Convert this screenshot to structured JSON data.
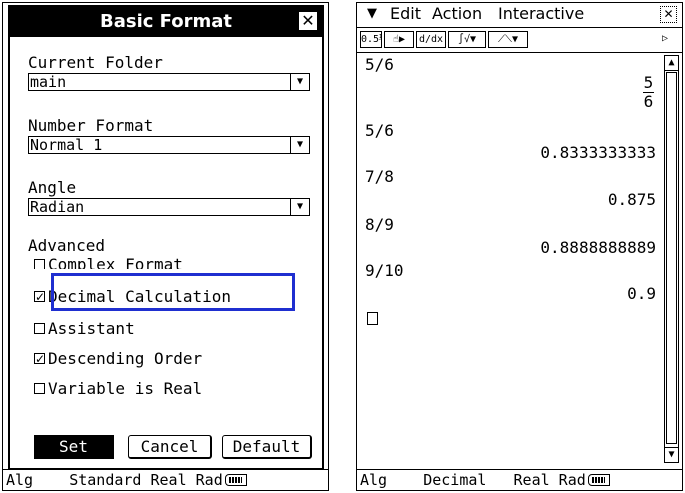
{
  "dialog": {
    "title": "Basic Format",
    "close_icon": "close-icon",
    "current_folder": {
      "label": "Current Folder",
      "value": "main"
    },
    "number_format": {
      "label": "Number Format",
      "value": "Normal 1"
    },
    "angle": {
      "label": "Angle",
      "value": "Radian"
    },
    "advanced": {
      "label": "Advanced",
      "options": [
        {
          "label": "Complex Format",
          "checked": false
        },
        {
          "label": "Decimal Calculation",
          "checked": true
        },
        {
          "label": "Assistant",
          "checked": false
        },
        {
          "label": "Descending Order",
          "checked": true
        },
        {
          "label": "Variable is Real",
          "checked": false
        }
      ]
    },
    "buttons": {
      "set": "Set",
      "cancel": "Cancel",
      "default": "Default"
    },
    "highlight_color": "#1f2fd0"
  },
  "left_status": {
    "text": "Alg    Standard Real Rad"
  },
  "right": {
    "menu": {
      "dropdown_icon": "menu-chevron-icon",
      "edit": "Edit",
      "action": "Action",
      "interactive": "Interactive"
    },
    "entries": [
      {
        "input": "5/6",
        "output_num": "5",
        "output_den": "6"
      },
      {
        "input": "5/6",
        "output": "0.8333333333"
      },
      {
        "input": "7/8",
        "output": "0.875"
      },
      {
        "input": "8/9",
        "output": "0.8888888889"
      },
      {
        "input": "9/10",
        "output": "0.9"
      }
    ],
    "status": {
      "text": "Alg    Decimal   Real Rad"
    }
  }
}
